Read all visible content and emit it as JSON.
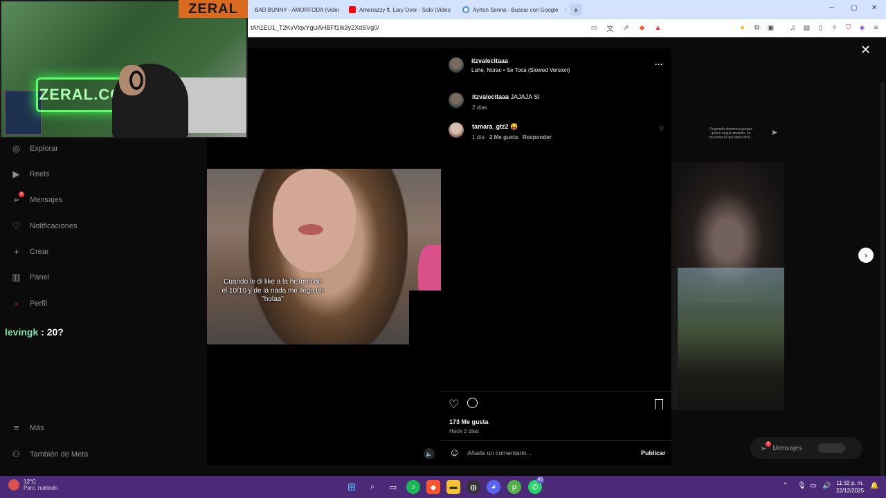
{
  "browser": {
    "tabs": [
      {
        "title": "BAD BUNNY - AMORFODA (Video O",
        "color": "#ff0000"
      },
      {
        "title": "Amenazzy ft. Lary Over - Solo (Video",
        "color": "#ff0000"
      },
      {
        "title": "Ayrton Senna - Buscar con Google",
        "color": "#4285f4"
      }
    ],
    "new_tab": "+",
    "url": "tAh1EU1_T2KvVlqvYgUAHBFf1Ik3y2XdSVg0/",
    "window_controls": {
      "minimize": "─",
      "maximize": "▢",
      "close": "✕"
    }
  },
  "stream": {
    "brand": "ZERAL",
    "neon_sign": "ZERAL.CO",
    "chat": {
      "user": "levingk",
      "text": ": 20?"
    }
  },
  "sidebar": {
    "items": [
      {
        "label": "Explorar",
        "icon": "compass-icon",
        "glyph": "◎"
      },
      {
        "label": "Reels",
        "icon": "reels-icon",
        "glyph": "▶"
      },
      {
        "label": "Mensajes",
        "icon": "messages-icon",
        "glyph": "➢",
        "badge": "6"
      },
      {
        "label": "Notificaciones",
        "icon": "heart-icon",
        "glyph": "♡"
      },
      {
        "label": "Crear",
        "icon": "plus-icon",
        "glyph": "+"
      },
      {
        "label": "Panel",
        "icon": "chart-icon",
        "glyph": "▥"
      },
      {
        "label": "Perfil",
        "icon": "profile-icon",
        "glyph": "●"
      },
      {
        "label": "Más",
        "icon": "menu-icon",
        "glyph": "≡"
      },
      {
        "label": "También de Meta",
        "icon": "meta-icon",
        "glyph": "⚇"
      }
    ]
  },
  "post": {
    "author": "itzvalecitaaa",
    "audio": "Luhe, Norac • Se Toca (Slowed Version)",
    "more": "···",
    "video_caption": "Cuando le di like a la historia de el 10/10 y de la nada me llega un \"holaa\"",
    "mute": "🔈"
  },
  "comments": [
    {
      "user": "itzvalecitaaa",
      "text": "JAJAJA SI",
      "time": "2 días",
      "likes": "",
      "reply": ""
    },
    {
      "user": "tamara_gtz2",
      "text": "😝",
      "time": "1 día",
      "likes": "2 Me gusta",
      "reply": "Responder"
    }
  ],
  "actions": {
    "likes": "173 Me gusta",
    "posted": "Hace 2 días",
    "comment_placeholder": "Añade un comentario...",
    "publish": "Publicar",
    "emoji": "☺"
  },
  "background": {
    "tile_text": "Fingiendo demencia porque quiero seguir amando, no escuchar lo que dicen de ti...",
    "messages_label": "Mensajes",
    "messages_badge": "6",
    "next": "›"
  },
  "taskbar": {
    "temp": "12°C",
    "condition": "Parc. nublado",
    "time": "11:32 p. m.",
    "date": "22/12/2025",
    "whatsapp_badge": "45"
  }
}
